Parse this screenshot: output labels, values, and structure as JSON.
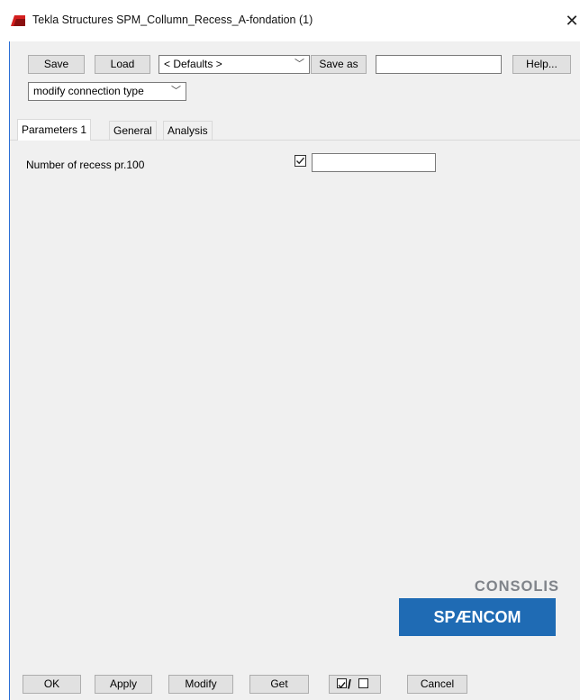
{
  "window": {
    "title": "Tekla Structures  SPM_Collumn_Recess_A-fondation (1)"
  },
  "toolbar": {
    "save_label": "Save",
    "load_label": "Load",
    "defaults_value": "< Defaults >",
    "save_as_label": "Save as",
    "save_as_value": "",
    "help_label": "Help...",
    "connection_type_value": "modify connection type"
  },
  "tabs": [
    {
      "label": "Parameters 1",
      "active": true
    },
    {
      "label": "General",
      "active": false
    },
    {
      "label": "Analysis",
      "active": false
    }
  ],
  "parameters": [
    {
      "label": "Number of recess pr.100",
      "checked": true,
      "value": ""
    }
  ],
  "logo": {
    "top": "CONSOLIS",
    "bottom": "SPÆNCOM"
  },
  "footer": {
    "ok_label": "OK",
    "apply_label": "Apply",
    "modify_label": "Modify",
    "get_label": "Get",
    "toggle_slash": "/",
    "cancel_label": "Cancel"
  },
  "colors": {
    "window_bg": "#f0f0f0",
    "window_border_accent": "#2a6fd6",
    "logo_blue": "#1f6bb4",
    "logo_gray": "#7f8389",
    "app_icon_red": "#d41f1f"
  },
  "icons": [
    "tekla-app-icon",
    "close-icon",
    "chevron-down-icon",
    "checkmark-icon"
  ]
}
